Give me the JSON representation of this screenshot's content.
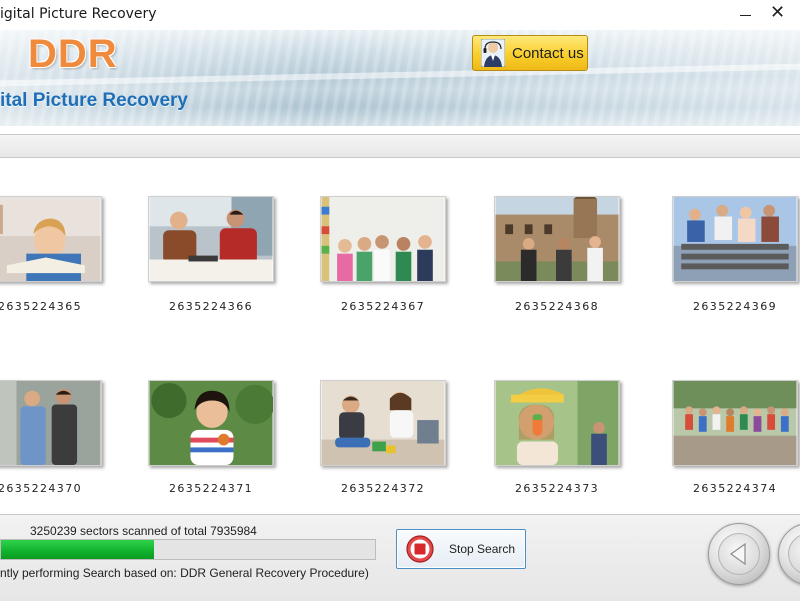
{
  "window": {
    "title": "igital Picture Recovery",
    "minimize_icon": "minimize-icon",
    "close_icon": "close-icon",
    "close_glyph": "✕"
  },
  "banner": {
    "logo": "DDR",
    "product_name": "ital Picture Recovery",
    "contact_button": {
      "label": "Contact us",
      "icon": "person-icon"
    },
    "colors": {
      "logo": "#f08a3c",
      "product": "#1f6fb8",
      "contact_bg": "#f9cf2e"
    }
  },
  "gallery": {
    "items": [
      {
        "id": "2635224365",
        "subject": "child reading book"
      },
      {
        "id": "2635224366",
        "subject": "two men talking at table"
      },
      {
        "id": "2635224367",
        "subject": "group of kids"
      },
      {
        "id": "2635224368",
        "subject": "people in front of building"
      },
      {
        "id": "2635224369",
        "subject": "friends on bench"
      },
      {
        "id": "2635224370",
        "subject": "two men outdoors"
      },
      {
        "id": "2635224371",
        "subject": "smiling girl"
      },
      {
        "id": "2635224372",
        "subject": "children playing on floor"
      },
      {
        "id": "2635224373",
        "subject": "girl with ice cream"
      },
      {
        "id": "2635224374",
        "subject": "runners on street"
      }
    ]
  },
  "status": {
    "sectors_text": "3250239 sectors scanned of total 7935984",
    "sectors_scanned": 3250239,
    "sectors_total": 7935984,
    "procedure_text": "ntly performing Search based on:  DDR General Recovery Procedure)",
    "progress_color": "#10b12c"
  },
  "controls": {
    "stop_button": {
      "label": "Stop Search",
      "icon": "stop-icon"
    },
    "back_button": {
      "icon": "back-arrow-icon"
    },
    "next_button": {
      "icon": "forward-arrow-icon"
    }
  }
}
